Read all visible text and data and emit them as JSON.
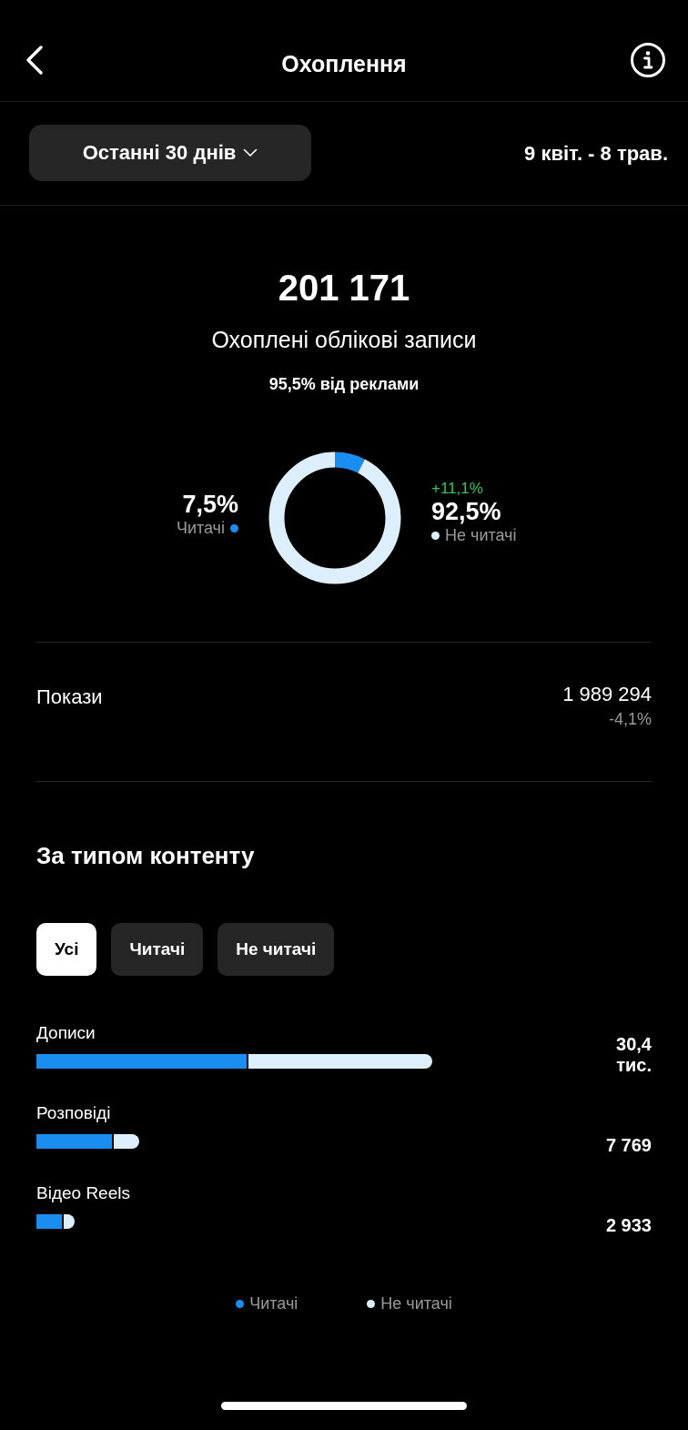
{
  "header": {
    "title": "Охоплення"
  },
  "period": {
    "label": "Останні 30 днів",
    "range": "9 квіт. - 8 трав."
  },
  "summary": {
    "total": "201 171",
    "label": "Охоплені облікові записи",
    "ads_note": "95,5% від реклами"
  },
  "audience": {
    "readers": {
      "percent": "7,5%",
      "label": "Читачі"
    },
    "non_readers": {
      "change": "+11,1%",
      "percent": "92,5%",
      "label": "Не читачі"
    }
  },
  "impressions": {
    "label": "Покази",
    "value": "1 989 294",
    "change": "-4,1%"
  },
  "content": {
    "title": "За типом контенту",
    "filters": [
      {
        "label": "Усі",
        "selected": true
      },
      {
        "label": "Читачі",
        "selected": false
      },
      {
        "label": "Не читачі",
        "selected": false
      }
    ],
    "rows": [
      {
        "name": "Дописи",
        "value": "30,4 тис."
      },
      {
        "name": "Розповіді",
        "value": "7 769"
      },
      {
        "name": "Відео Reels",
        "value": "2 933"
      }
    ],
    "legend": [
      "Читачі",
      "Не читачі"
    ]
  }
}
